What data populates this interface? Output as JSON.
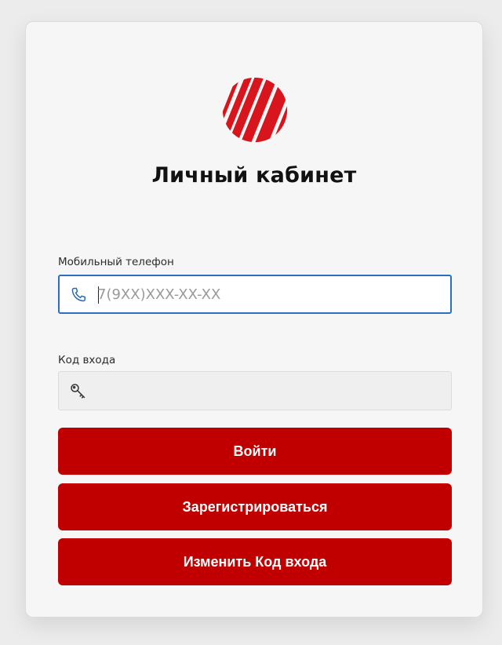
{
  "header": {
    "logo_icon": "red-sunburst-logo",
    "title": "Личный кабинет"
  },
  "phone_field": {
    "label": "Мобильный телефон",
    "placeholder": "7(9XX)XXX-XX-XX",
    "value": "",
    "icon": "phone-icon"
  },
  "code_field": {
    "label": "Код входа",
    "placeholder": "",
    "value": "",
    "icon": "key-icon"
  },
  "buttons": {
    "login_label": "Войти",
    "register_label": "Зарегистрироваться",
    "change_code_label": "Изменить Код входа"
  },
  "colors": {
    "brand_red": "#c00000",
    "logo_red": "#d8151c",
    "focus_blue": "#2b6fc0",
    "phone_icon_blue": "#2a69b8"
  }
}
